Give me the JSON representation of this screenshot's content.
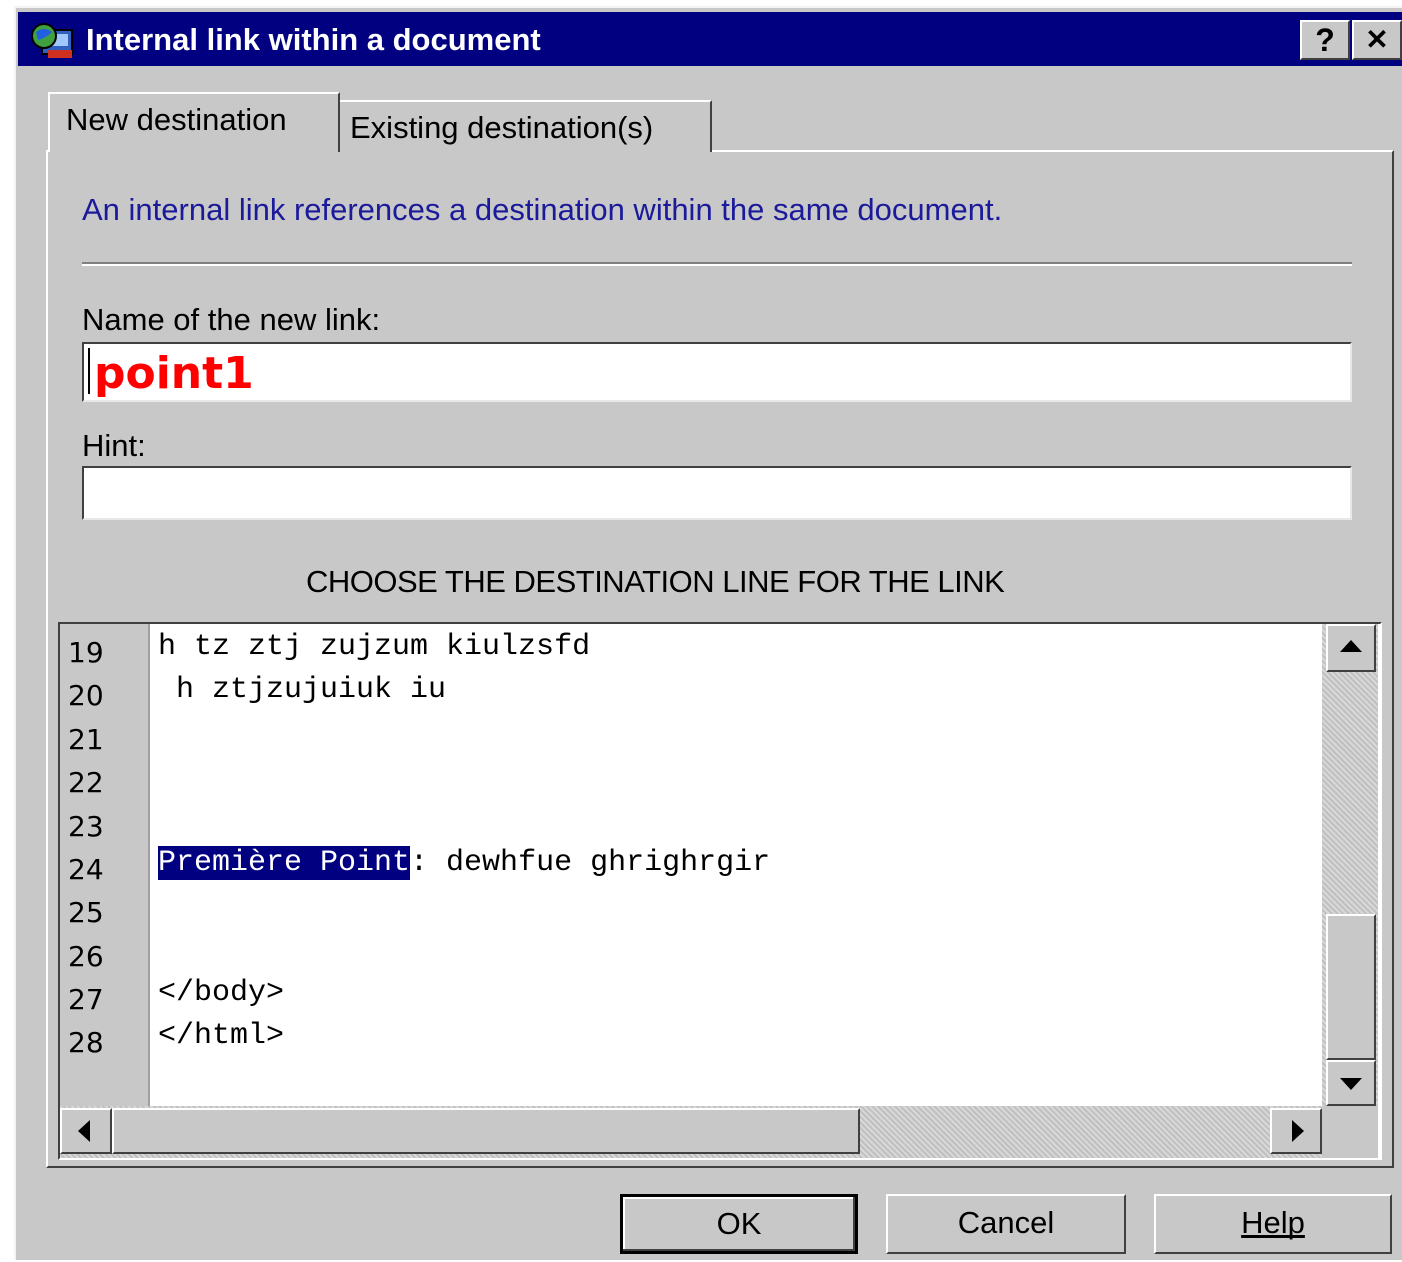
{
  "window": {
    "title": "Internal link within a document",
    "help_button": "?",
    "close_button": "✕"
  },
  "tabs": [
    {
      "label": "New destination",
      "active": true
    },
    {
      "label": "Existing destination(s)",
      "active": false
    }
  ],
  "info_text": "An internal link references a destination within the same document.",
  "name_field": {
    "label": "Name of the new link:",
    "value": "point1"
  },
  "hint_field": {
    "label": "Hint:",
    "value": ""
  },
  "destination_heading": "CHOOSE THE DESTINATION LINE FOR THE LINK",
  "editor": {
    "line_numbers": [
      "19",
      "20",
      "21",
      "22",
      "23",
      "24",
      "25",
      "26",
      "27",
      "28"
    ],
    "lines": [
      "h tz ztj zujzum kiulzsfd",
      " h ztjzujuiuk iu",
      "",
      "",
      "",
      "",
      "",
      "",
      "</body>",
      "</html>"
    ],
    "selected_line": {
      "selection": "Première Point",
      "rest": ": dewhfue ghrighrgir"
    }
  },
  "buttons": {
    "ok": "OK",
    "cancel": "Cancel",
    "help": "Help"
  },
  "colors": {
    "title_bar": "#000080",
    "selection": "#000080",
    "name_value": "#ff0000",
    "info_text": "#1a1a9a"
  }
}
